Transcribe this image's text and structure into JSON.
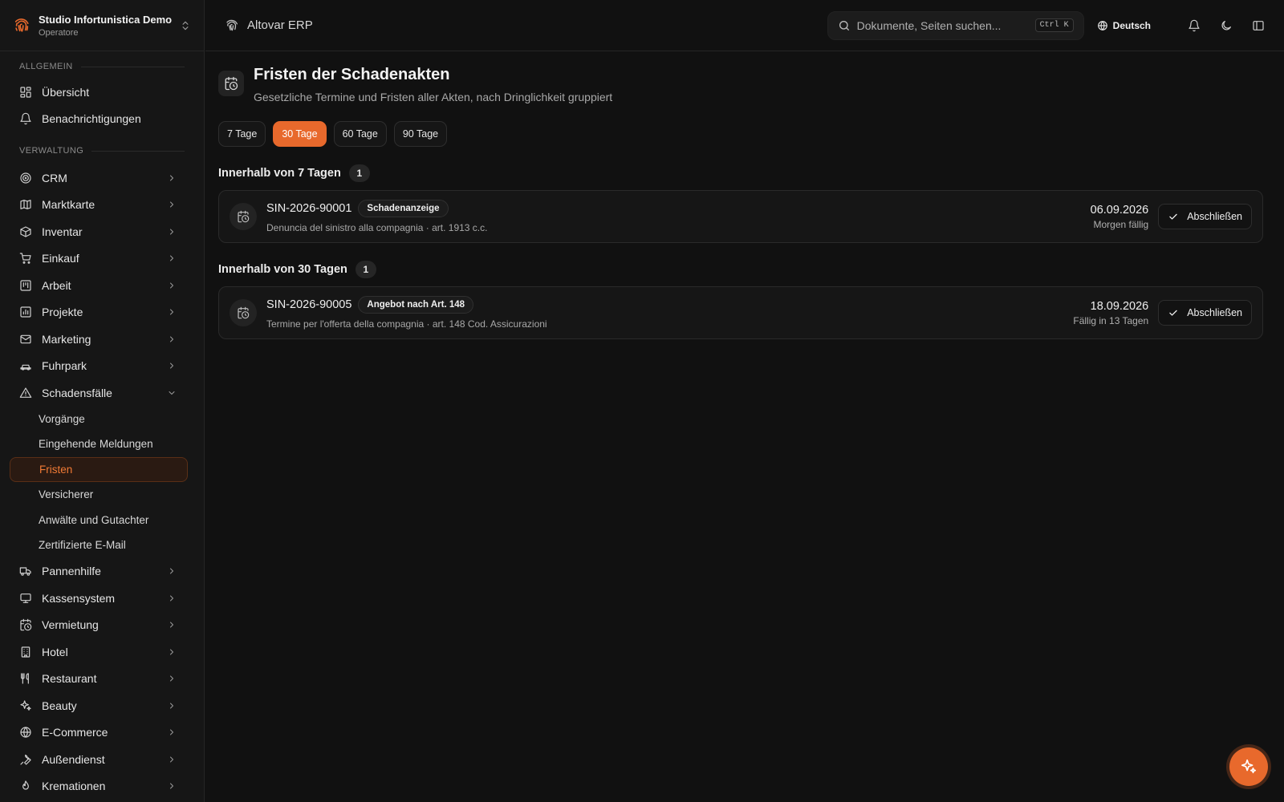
{
  "brand": {
    "name": "Studio Infortunistica Demo",
    "role": "Operatore"
  },
  "topbar": {
    "app_title": "Altovar ERP",
    "search_placeholder": "Dokumente, Seiten suchen...",
    "search_shortcut": "Ctrl K",
    "language": "Deutsch"
  },
  "sidebar": {
    "group_general": "ALLGEMEIN",
    "general": [
      {
        "label": "Übersicht",
        "icon": "dashboard-icon"
      },
      {
        "label": "Benachrichtigungen",
        "icon": "bell-icon"
      }
    ],
    "group_admin": "VERWALTUNG",
    "admin_top": [
      {
        "label": "CRM",
        "icon": "target-icon"
      },
      {
        "label": "Marktkarte",
        "icon": "map-icon"
      },
      {
        "label": "Inventar",
        "icon": "package-icon"
      },
      {
        "label": "Einkauf",
        "icon": "cart-icon"
      },
      {
        "label": "Arbeit",
        "icon": "kanban-icon"
      },
      {
        "label": "Projekte",
        "icon": "chart-icon"
      },
      {
        "label": "Marketing",
        "icon": "mail-icon"
      },
      {
        "label": "Fuhrpark",
        "icon": "car-icon"
      }
    ],
    "claims": {
      "label": "Schadensfälle",
      "icon": "warning-icon"
    },
    "claims_sub": [
      {
        "label": "Vorgänge",
        "active": false
      },
      {
        "label": "Eingehende Meldungen",
        "active": false
      },
      {
        "label": "Fristen",
        "active": true
      },
      {
        "label": "Versicherer",
        "active": false
      },
      {
        "label": "Anwälte und Gutachter",
        "active": false
      },
      {
        "label": "Zertifizierte E-Mail",
        "active": false
      }
    ],
    "admin_bottom": [
      {
        "label": "Pannenhilfe",
        "icon": "truck-icon"
      },
      {
        "label": "Kassensystem",
        "icon": "monitor-icon"
      },
      {
        "label": "Vermietung",
        "icon": "calendar-clock-icon"
      },
      {
        "label": "Hotel",
        "icon": "building-icon"
      },
      {
        "label": "Restaurant",
        "icon": "utensils-icon"
      },
      {
        "label": "Beauty",
        "icon": "sparkles-icon"
      },
      {
        "label": "E-Commerce",
        "icon": "globe-icon"
      },
      {
        "label": "Außendienst",
        "icon": "wrench-icon"
      },
      {
        "label": "Kremationen",
        "icon": "flame-icon"
      }
    ]
  },
  "page": {
    "title": "Fristen der Schadenakten",
    "subtitle": "Gesetzliche Termine und Fristen aller Akten, nach Dringlichkeit gruppiert",
    "filters": [
      {
        "label": "7 Tage",
        "active": false
      },
      {
        "label": "30 Tage",
        "active": true
      },
      {
        "label": "60 Tage",
        "active": false
      },
      {
        "label": "90 Tage",
        "active": false
      }
    ],
    "sections": [
      {
        "title": "Innerhalb von 7 Tagen",
        "count": "1",
        "items": [
          {
            "id": "SIN-2026-90001",
            "tag": "Schadenanzeige",
            "description": "Denuncia del sinistro alla compagnia · art. 1913 c.c.",
            "date": "06.09.2026",
            "due": "Morgen fällig",
            "action": "Abschließen"
          }
        ]
      },
      {
        "title": "Innerhalb von 30 Tagen",
        "count": "1",
        "items": [
          {
            "id": "SIN-2026-90005",
            "tag": "Angebot nach Art. 148",
            "description": "Termine per l'offerta della compagnia · art. 148 Cod. Assicurazioni",
            "date": "18.09.2026",
            "due": "Fällig in 13 Tagen",
            "action": "Abschließen"
          }
        ]
      }
    ]
  },
  "colors": {
    "accent": "#e8692c",
    "background": "#111111",
    "sidebar": "#161616"
  }
}
